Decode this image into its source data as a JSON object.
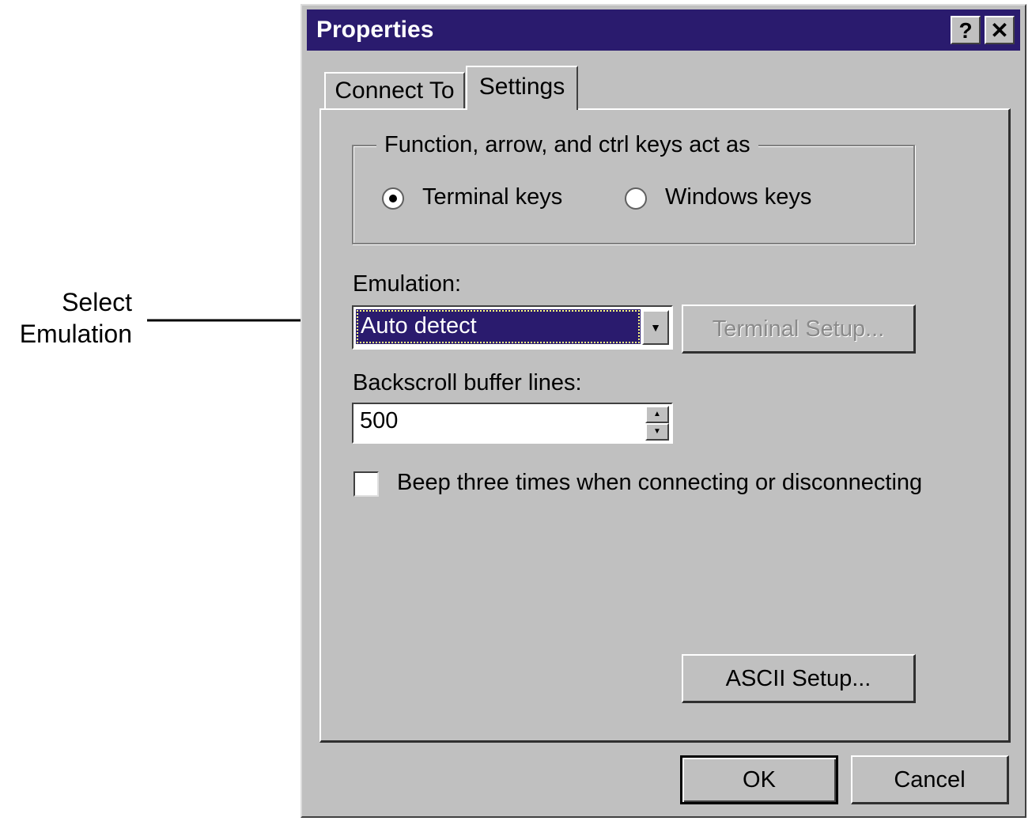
{
  "callout": {
    "line1": "Select",
    "line2": "Emulation"
  },
  "window": {
    "title": "Properties",
    "help_label": "?",
    "close_label": "✕"
  },
  "tabs": [
    {
      "label": "Connect To",
      "active": false
    },
    {
      "label": "Settings",
      "active": true
    }
  ],
  "keys_group": {
    "legend": "Function, arrow, and ctrl keys act as",
    "options": [
      {
        "label": "Terminal keys",
        "selected": true
      },
      {
        "label": "Windows keys",
        "selected": false
      }
    ]
  },
  "emulation": {
    "label": "Emulation:",
    "value": "Auto detect",
    "terminal_setup_label": "Terminal Setup...",
    "terminal_setup_enabled": false
  },
  "backscroll": {
    "label": "Backscroll buffer lines:",
    "value": "500"
  },
  "beep": {
    "label": "Beep three times when connecting or disconnecting",
    "checked": false
  },
  "ascii_setup_label": "ASCII Setup...",
  "ok_label": "OK",
  "cancel_label": "Cancel",
  "colors": {
    "titlebar": "#2a1b6e",
    "face": "#c0c0c0",
    "selection": "#2a1b6e"
  }
}
